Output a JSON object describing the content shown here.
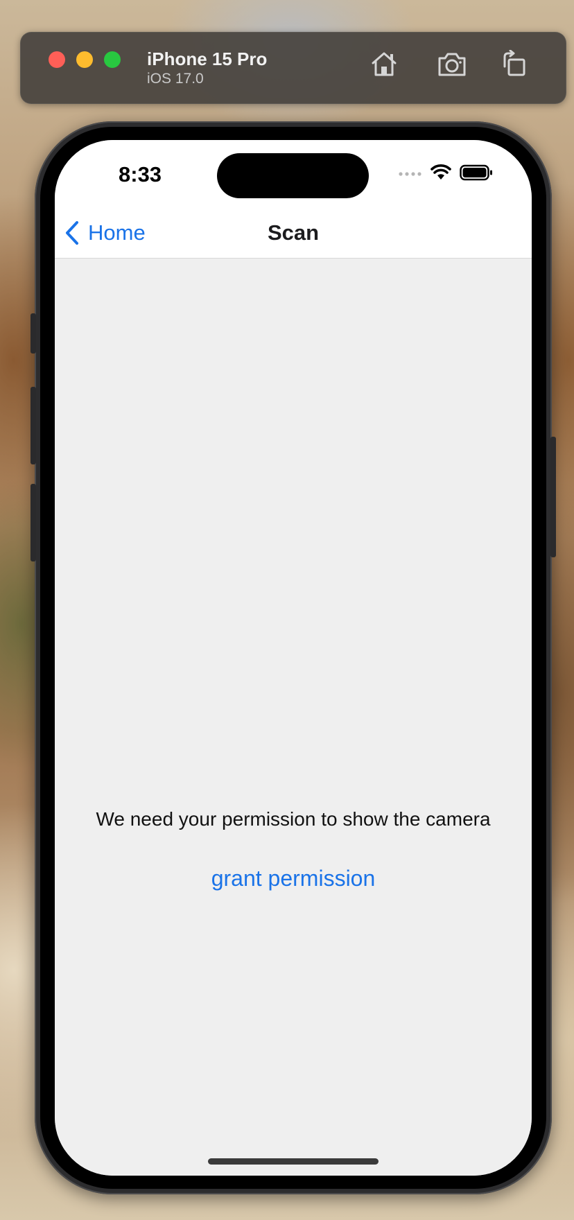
{
  "simulator": {
    "device_name": "iPhone 15 Pro",
    "os_version": "iOS 17.0",
    "toolbar_icons": [
      "home-icon",
      "screenshot-icon",
      "rotate-icon"
    ],
    "window_controls": {
      "close_color": "#fe5f57",
      "minimize_color": "#febc2e",
      "zoom_color": "#28c840"
    }
  },
  "status_bar": {
    "time": "8:33",
    "icons": [
      "cellular-icon",
      "wifi-icon",
      "battery-icon"
    ]
  },
  "nav": {
    "back_label": "Home",
    "title": "Scan"
  },
  "content": {
    "message": "We need your permission to show the camera",
    "grant_button_label": "grant permission"
  },
  "colors": {
    "accent": "#1a73e8",
    "background": "#efefef",
    "nav_background": "#ffffff"
  }
}
